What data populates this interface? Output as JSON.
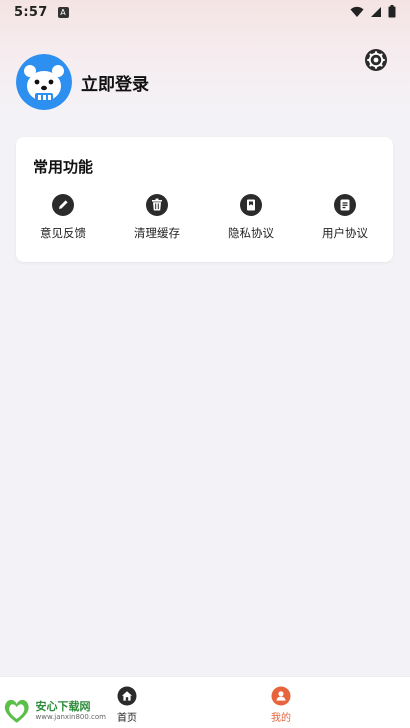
{
  "status_bar": {
    "time": "5:57",
    "notification_badge": "A"
  },
  "profile": {
    "login_label": "立即登录"
  },
  "common_functions": {
    "title": "常用功能",
    "items": [
      {
        "label": "意见反馈",
        "icon": "pencil-icon"
      },
      {
        "label": "清理缓存",
        "icon": "trash-icon"
      },
      {
        "label": "隐私协议",
        "icon": "privacy-doc-icon"
      },
      {
        "label": "用户协议",
        "icon": "user-doc-icon"
      }
    ]
  },
  "bottom_nav": {
    "items": [
      {
        "label": "首页",
        "icon": "home-icon",
        "active": false
      },
      {
        "label": "我的",
        "icon": "person-icon",
        "active": true
      }
    ]
  },
  "watermark": {
    "brand": "安心下载网",
    "url": "www.janxin800.com"
  },
  "colors": {
    "accent": "#e8643c",
    "icon_dark": "#2b2b2b",
    "background": "#f3f3f7"
  }
}
